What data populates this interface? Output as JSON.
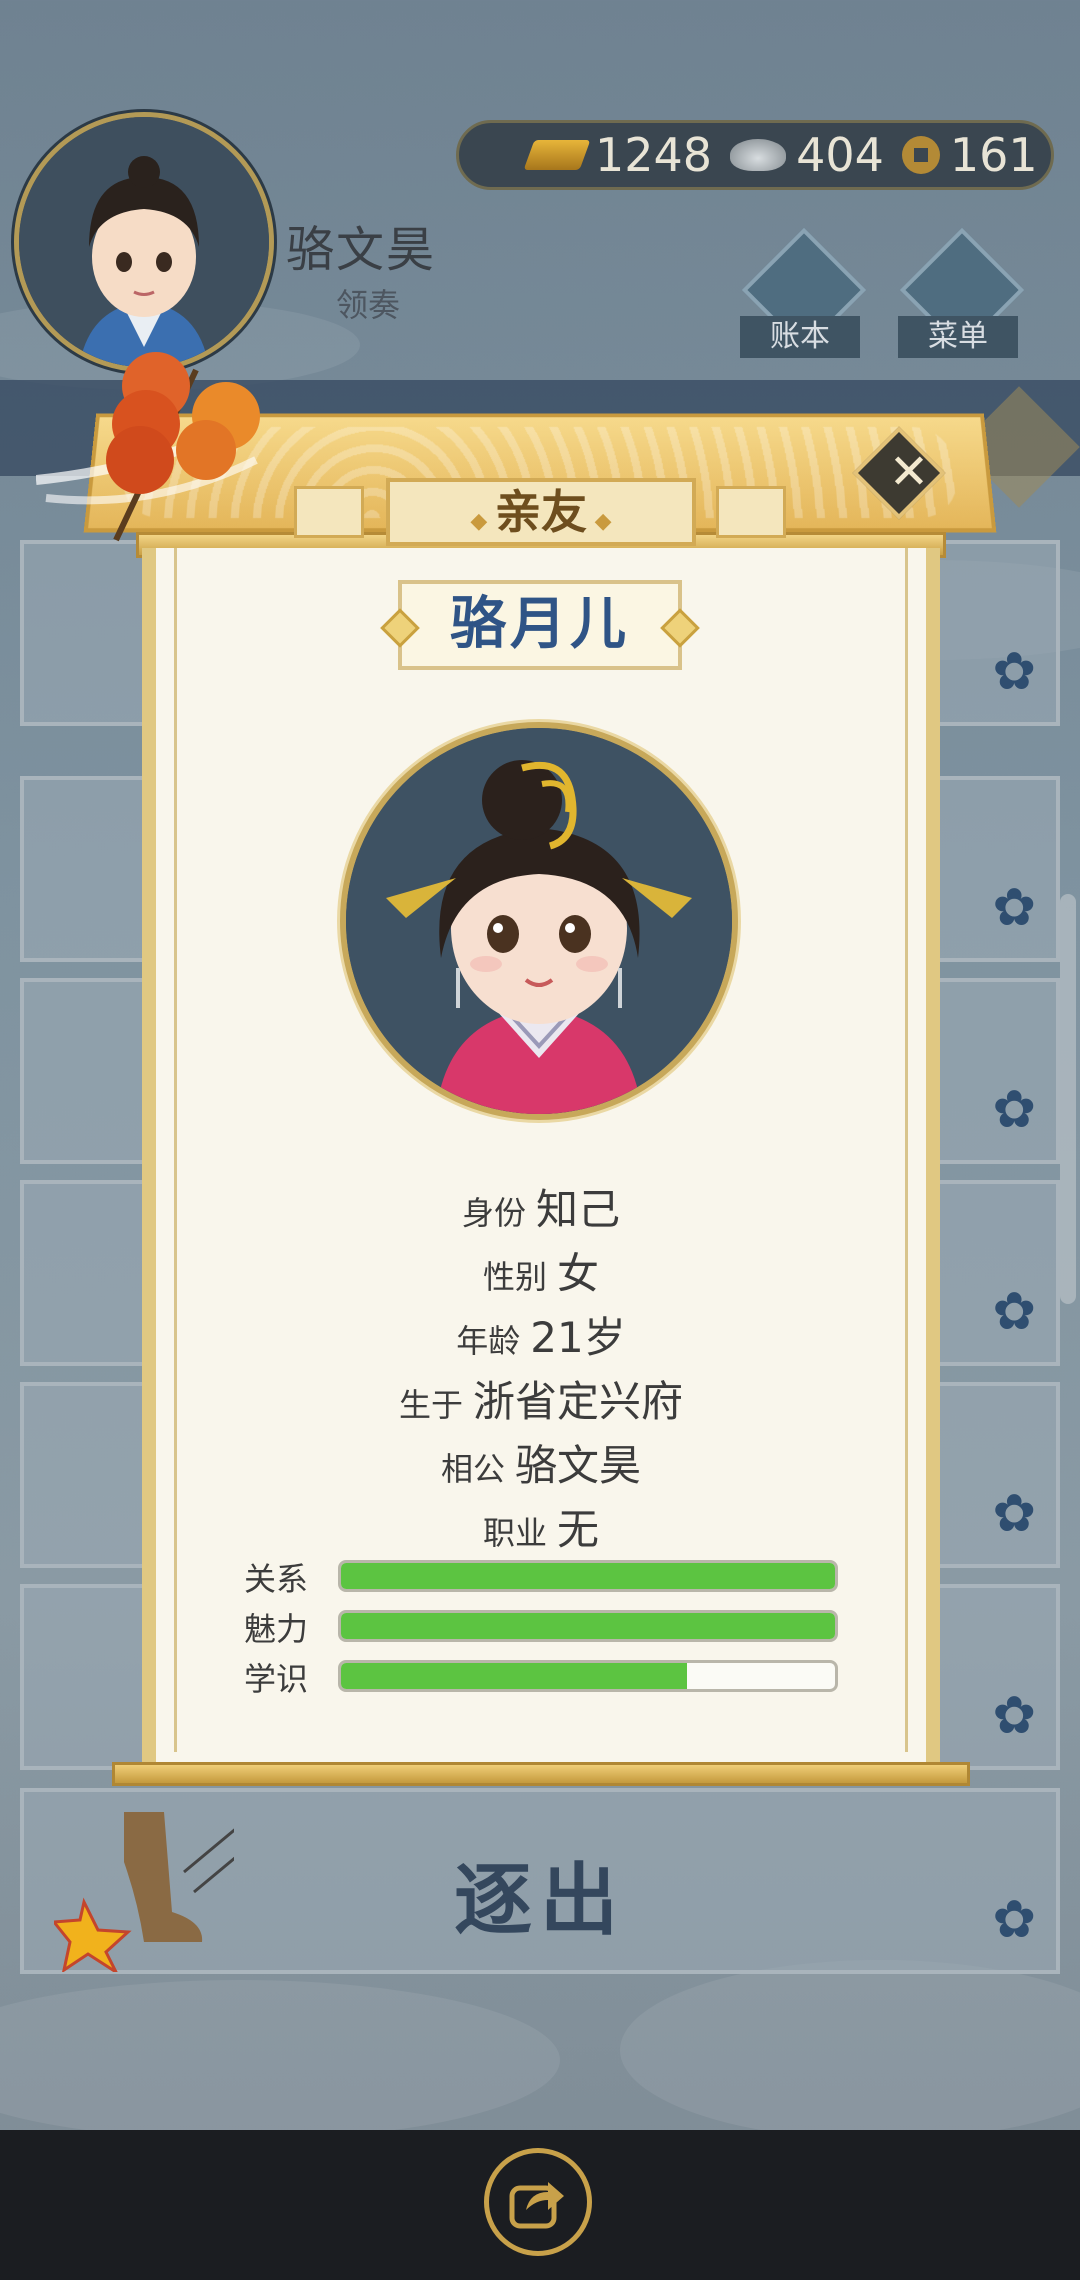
{
  "player": {
    "name": "骆文昊",
    "title": "领奏"
  },
  "currency": {
    "gold": "1248",
    "silver": "404",
    "coin": "161"
  },
  "menu": {
    "ledger_label": "账本",
    "menu_label": "菜单"
  },
  "background": {
    "expel_label": "逐出"
  },
  "dialog": {
    "title": "亲友",
    "name": "骆月儿",
    "info": [
      {
        "key": "身份",
        "value": "知己"
      },
      {
        "key": "性别",
        "value": "女"
      },
      {
        "key": "年龄",
        "value": "21岁"
      },
      {
        "key": "生于",
        "value": "浙省定兴府"
      },
      {
        "key": "相公",
        "value": "骆文昊"
      },
      {
        "key": "职业",
        "value": "无"
      }
    ],
    "stats": [
      {
        "label": "关系",
        "level": 1.0
      },
      {
        "label": "魅力",
        "level": 1.0
      },
      {
        "label": "学识",
        "level": 0.7
      }
    ]
  },
  "colors": {
    "bar_fill": "#5cc441",
    "title_text": "#2f5486",
    "accent_gold": "#c7a85a"
  },
  "icons": [
    "gold-ingot-icon",
    "silver-ingot-icon",
    "copper-coin-icon",
    "close-icon",
    "share-icon",
    "flower-icon",
    "ledger-icon",
    "menu-dots-icon"
  ]
}
